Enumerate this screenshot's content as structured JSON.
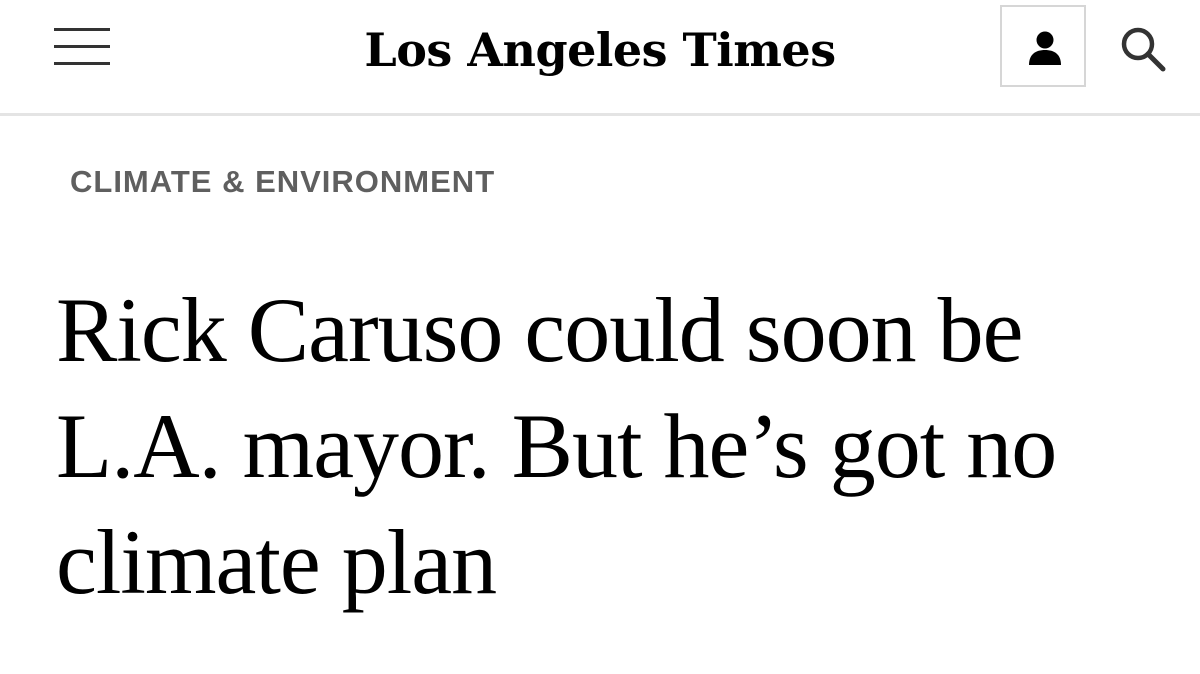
{
  "header": {
    "menu_icon": "hamburger-menu-icon",
    "logo_text": "Los Angeles Times",
    "account_icon": "user-icon",
    "search_icon": "search-icon"
  },
  "article": {
    "section": "CLIMATE & ENVIRONMENT",
    "headline": "Rick Caruso could soon be L.A. mayor. But he’s got no climate plan"
  },
  "colors": {
    "section_label": "#5f5f5f",
    "divider": "#e4e4e4",
    "text": "#000000"
  }
}
